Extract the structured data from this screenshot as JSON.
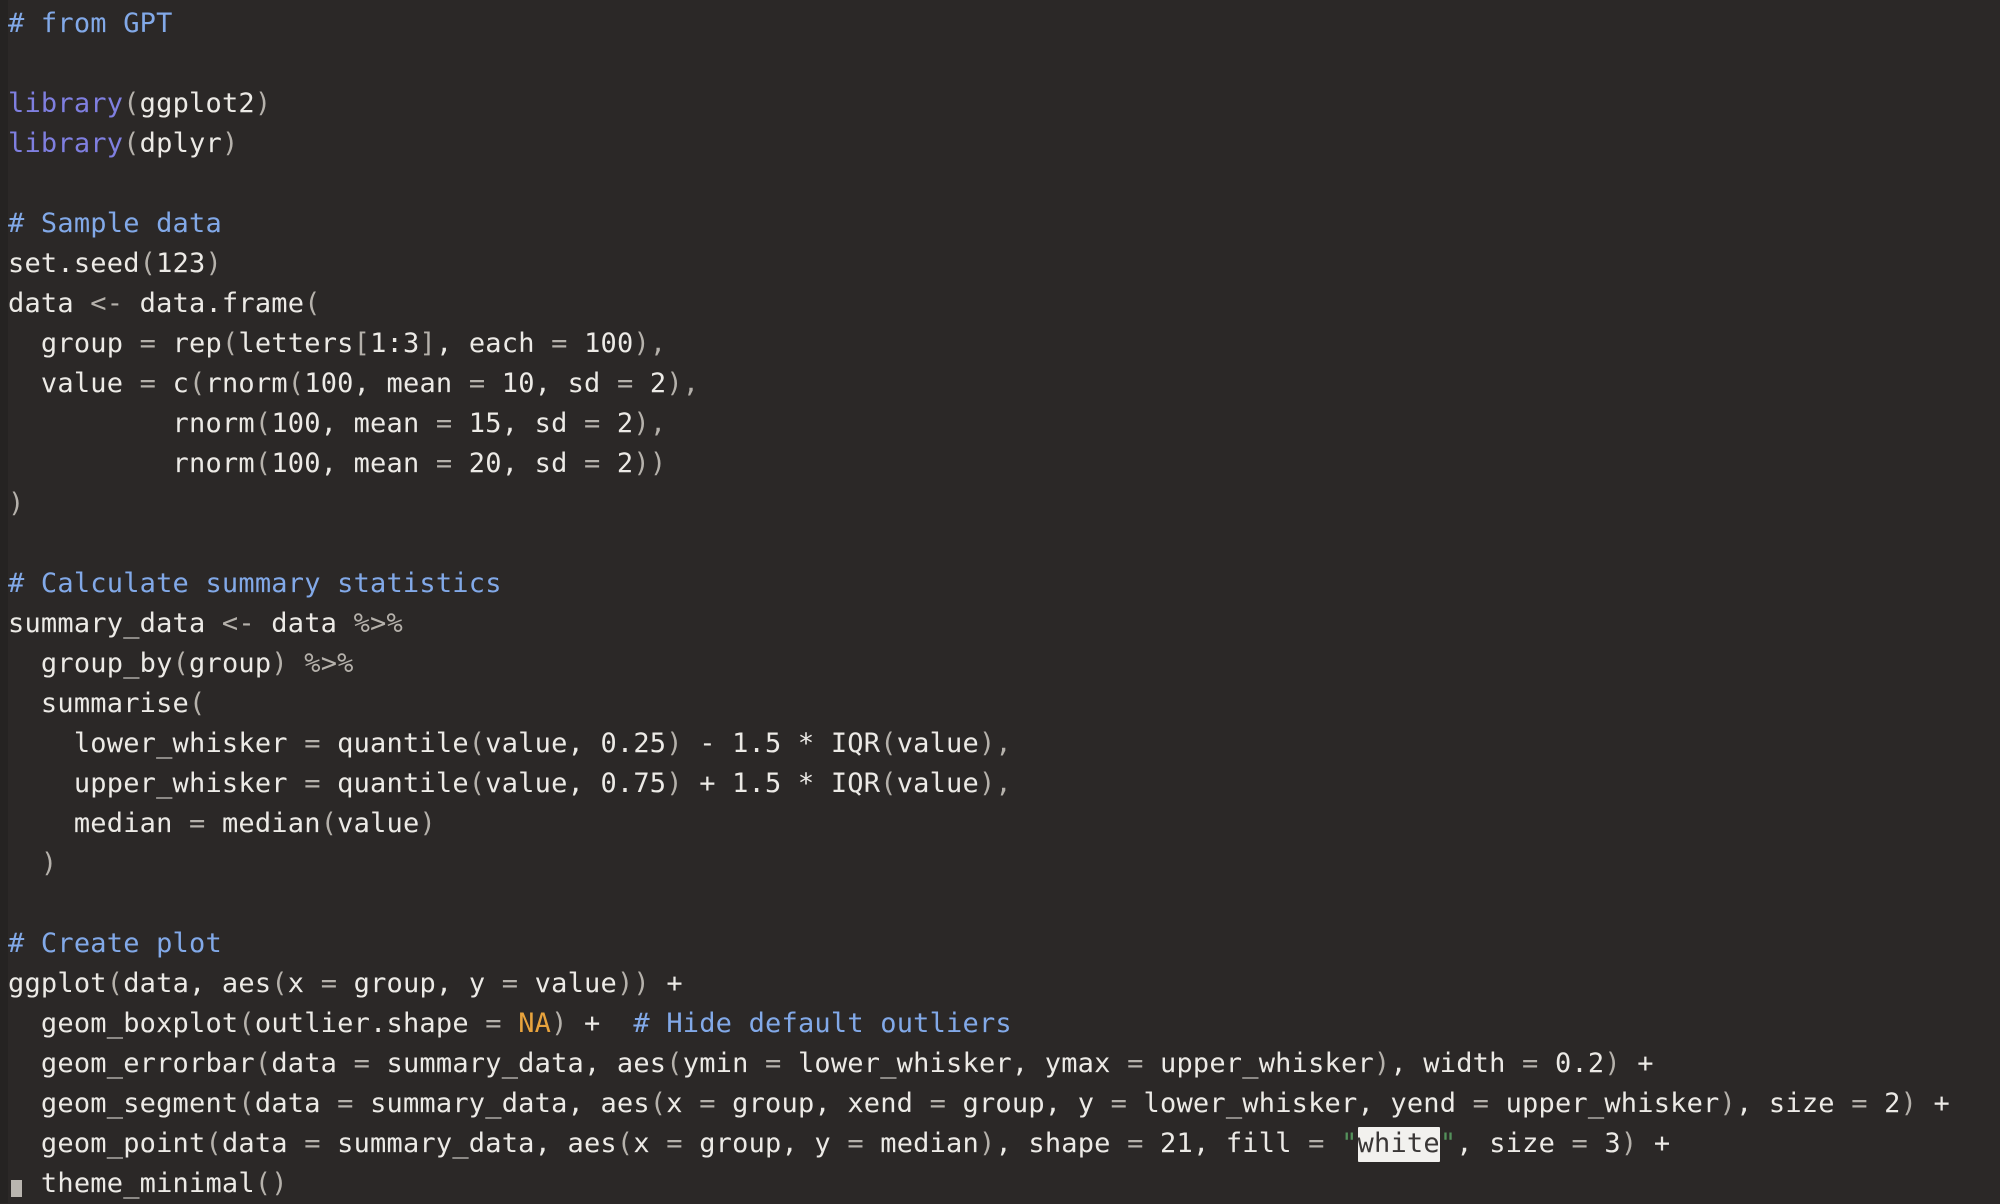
{
  "editor": {
    "language": "R",
    "theme": "dark",
    "background_color": "#2b2827",
    "gutter_color": "#252322",
    "colors": {
      "comment": "#82a9e8",
      "keyword": "#7f7fe0",
      "plain_text": "#eceae6",
      "punctuation": "#b5b1ab",
      "constant": "#e8a33d",
      "string": "#54915b",
      "selection_background": "#f2f1ee",
      "selection_text": "#3a3736",
      "caret": "#b9b5af"
    },
    "selection": {
      "selected_text": "white"
    },
    "caret": {
      "name": "text-cursor",
      "visible": true
    }
  },
  "code": {
    "lines": [
      {
        "n": 1,
        "segments": [
          {
            "t": "# from GPT",
            "c": "comment"
          }
        ]
      },
      {
        "n": 2,
        "segments": []
      },
      {
        "n": 3,
        "segments": [
          {
            "t": "library",
            "c": "keyword"
          },
          {
            "t": "(",
            "c": "punct"
          },
          {
            "t": "ggplot2",
            "c": "plain"
          },
          {
            "t": ")",
            "c": "punct"
          }
        ]
      },
      {
        "n": 4,
        "segments": [
          {
            "t": "library",
            "c": "keyword"
          },
          {
            "t": "(",
            "c": "punct"
          },
          {
            "t": "dplyr",
            "c": "plain"
          },
          {
            "t": ")",
            "c": "punct"
          }
        ]
      },
      {
        "n": 5,
        "segments": []
      },
      {
        "n": 6,
        "segments": [
          {
            "t": "# Sample data",
            "c": "comment"
          }
        ]
      },
      {
        "n": 7,
        "segments": [
          {
            "t": "set.seed",
            "c": "plain"
          },
          {
            "t": "(",
            "c": "punct"
          },
          {
            "t": "123",
            "c": "plain"
          },
          {
            "t": ")",
            "c": "punct"
          }
        ]
      },
      {
        "n": 8,
        "segments": [
          {
            "t": "data ",
            "c": "plain"
          },
          {
            "t": "<-",
            "c": "punct"
          },
          {
            "t": " data.frame",
            "c": "plain"
          },
          {
            "t": "(",
            "c": "punct"
          }
        ]
      },
      {
        "n": 9,
        "segments": [
          {
            "t": "  group ",
            "c": "plain"
          },
          {
            "t": "=",
            "c": "punct"
          },
          {
            "t": " rep",
            "c": "plain"
          },
          {
            "t": "(",
            "c": "punct"
          },
          {
            "t": "letters",
            "c": "plain"
          },
          {
            "t": "[",
            "c": "punct"
          },
          {
            "t": "1:3",
            "c": "plain"
          },
          {
            "t": "]",
            "c": "punct"
          },
          {
            "t": ", each ",
            "c": "plain"
          },
          {
            "t": "=",
            "c": "punct"
          },
          {
            "t": " 100",
            "c": "plain"
          },
          {
            "t": "),",
            "c": "punct"
          }
        ]
      },
      {
        "n": 10,
        "segments": [
          {
            "t": "  value ",
            "c": "plain"
          },
          {
            "t": "=",
            "c": "punct"
          },
          {
            "t": " c",
            "c": "plain"
          },
          {
            "t": "(",
            "c": "punct"
          },
          {
            "t": "rnorm",
            "c": "plain"
          },
          {
            "t": "(",
            "c": "punct"
          },
          {
            "t": "100, mean ",
            "c": "plain"
          },
          {
            "t": "=",
            "c": "punct"
          },
          {
            "t": " 10, sd ",
            "c": "plain"
          },
          {
            "t": "=",
            "c": "punct"
          },
          {
            "t": " 2",
            "c": "plain"
          },
          {
            "t": "),",
            "c": "punct"
          }
        ]
      },
      {
        "n": 11,
        "segments": [
          {
            "t": "          rnorm",
            "c": "plain"
          },
          {
            "t": "(",
            "c": "punct"
          },
          {
            "t": "100, mean ",
            "c": "plain"
          },
          {
            "t": "=",
            "c": "punct"
          },
          {
            "t": " 15, sd ",
            "c": "plain"
          },
          {
            "t": "=",
            "c": "punct"
          },
          {
            "t": " 2",
            "c": "plain"
          },
          {
            "t": "),",
            "c": "punct"
          }
        ]
      },
      {
        "n": 12,
        "segments": [
          {
            "t": "          rnorm",
            "c": "plain"
          },
          {
            "t": "(",
            "c": "punct"
          },
          {
            "t": "100, mean ",
            "c": "plain"
          },
          {
            "t": "=",
            "c": "punct"
          },
          {
            "t": " 20, sd ",
            "c": "plain"
          },
          {
            "t": "=",
            "c": "punct"
          },
          {
            "t": " 2",
            "c": "plain"
          },
          {
            "t": "))",
            "c": "punct"
          }
        ]
      },
      {
        "n": 13,
        "segments": [
          {
            "t": ")",
            "c": "punct"
          }
        ]
      },
      {
        "n": 14,
        "segments": []
      },
      {
        "n": 15,
        "segments": [
          {
            "t": "# Calculate summary statistics",
            "c": "comment"
          }
        ]
      },
      {
        "n": 16,
        "segments": [
          {
            "t": "summary_data ",
            "c": "plain"
          },
          {
            "t": "<-",
            "c": "punct"
          },
          {
            "t": " data ",
            "c": "plain"
          },
          {
            "t": "%>%",
            "c": "punct"
          }
        ]
      },
      {
        "n": 17,
        "segments": [
          {
            "t": "  group_by",
            "c": "plain"
          },
          {
            "t": "(",
            "c": "punct"
          },
          {
            "t": "group",
            "c": "plain"
          },
          {
            "t": ")",
            "c": "punct"
          },
          {
            "t": " ",
            "c": "plain"
          },
          {
            "t": "%>%",
            "c": "punct"
          }
        ]
      },
      {
        "n": 18,
        "segments": [
          {
            "t": "  summarise",
            "c": "plain"
          },
          {
            "t": "(",
            "c": "punct"
          }
        ]
      },
      {
        "n": 19,
        "segments": [
          {
            "t": "    lower_whisker ",
            "c": "plain"
          },
          {
            "t": "=",
            "c": "punct"
          },
          {
            "t": " quantile",
            "c": "plain"
          },
          {
            "t": "(",
            "c": "punct"
          },
          {
            "t": "value, 0.25",
            "c": "plain"
          },
          {
            "t": ")",
            "c": "punct"
          },
          {
            "t": " - 1.5 * ",
            "c": "plain"
          },
          {
            "t": "IQR",
            "c": "plain"
          },
          {
            "t": "(",
            "c": "punct"
          },
          {
            "t": "value",
            "c": "plain"
          },
          {
            "t": "),",
            "c": "punct"
          }
        ]
      },
      {
        "n": 20,
        "segments": [
          {
            "t": "    upper_whisker ",
            "c": "plain"
          },
          {
            "t": "=",
            "c": "punct"
          },
          {
            "t": " quantile",
            "c": "plain"
          },
          {
            "t": "(",
            "c": "punct"
          },
          {
            "t": "value, 0.75",
            "c": "plain"
          },
          {
            "t": ")",
            "c": "punct"
          },
          {
            "t": " + 1.5 * ",
            "c": "plain"
          },
          {
            "t": "IQR",
            "c": "plain"
          },
          {
            "t": "(",
            "c": "punct"
          },
          {
            "t": "value",
            "c": "plain"
          },
          {
            "t": "),",
            "c": "punct"
          }
        ]
      },
      {
        "n": 21,
        "segments": [
          {
            "t": "    median ",
            "c": "plain"
          },
          {
            "t": "=",
            "c": "punct"
          },
          {
            "t": " median",
            "c": "plain"
          },
          {
            "t": "(",
            "c": "punct"
          },
          {
            "t": "value",
            "c": "plain"
          },
          {
            "t": ")",
            "c": "punct"
          }
        ]
      },
      {
        "n": 22,
        "segments": [
          {
            "t": "  ",
            "c": "plain"
          },
          {
            "t": ")",
            "c": "punct"
          }
        ]
      },
      {
        "n": 23,
        "segments": []
      },
      {
        "n": 24,
        "segments": [
          {
            "t": "# Create plot",
            "c": "comment"
          }
        ]
      },
      {
        "n": 25,
        "segments": [
          {
            "t": "ggplot",
            "c": "plain"
          },
          {
            "t": "(",
            "c": "punct"
          },
          {
            "t": "data, aes",
            "c": "plain"
          },
          {
            "t": "(",
            "c": "punct"
          },
          {
            "t": "x ",
            "c": "plain"
          },
          {
            "t": "=",
            "c": "punct"
          },
          {
            "t": " group, y ",
            "c": "plain"
          },
          {
            "t": "=",
            "c": "punct"
          },
          {
            "t": " value",
            "c": "plain"
          },
          {
            "t": "))",
            "c": "punct"
          },
          {
            "t": " + ",
            "c": "plain"
          }
        ]
      },
      {
        "n": 26,
        "segments": [
          {
            "t": "  geom_boxplot",
            "c": "plain"
          },
          {
            "t": "(",
            "c": "punct"
          },
          {
            "t": "outlier.shape ",
            "c": "plain"
          },
          {
            "t": "=",
            "c": "punct"
          },
          {
            "t": " ",
            "c": "plain"
          },
          {
            "t": "NA",
            "c": "const"
          },
          {
            "t": ")",
            "c": "punct"
          },
          {
            "t": " + ",
            "c": "plain"
          },
          {
            "t": " # Hide default outliers",
            "c": "comment"
          }
        ]
      },
      {
        "n": 27,
        "segments": [
          {
            "t": "  geom_errorbar",
            "c": "plain"
          },
          {
            "t": "(",
            "c": "punct"
          },
          {
            "t": "data ",
            "c": "plain"
          },
          {
            "t": "=",
            "c": "punct"
          },
          {
            "t": " summary_data, aes",
            "c": "plain"
          },
          {
            "t": "(",
            "c": "punct"
          },
          {
            "t": "ymin ",
            "c": "plain"
          },
          {
            "t": "=",
            "c": "punct"
          },
          {
            "t": " lower_whisker, ymax ",
            "c": "plain"
          },
          {
            "t": "=",
            "c": "punct"
          },
          {
            "t": " upper_whisker",
            "c": "plain"
          },
          {
            "t": ")",
            "c": "punct"
          },
          {
            "t": ", width ",
            "c": "plain"
          },
          {
            "t": "=",
            "c": "punct"
          },
          {
            "t": " 0.2",
            "c": "plain"
          },
          {
            "t": ")",
            "c": "punct"
          },
          {
            "t": " + ",
            "c": "plain"
          }
        ]
      },
      {
        "n": 28,
        "segments": [
          {
            "t": "  geom_segment",
            "c": "plain"
          },
          {
            "t": "(",
            "c": "punct"
          },
          {
            "t": "data ",
            "c": "plain"
          },
          {
            "t": "=",
            "c": "punct"
          },
          {
            "t": " summary_data, aes",
            "c": "plain"
          },
          {
            "t": "(",
            "c": "punct"
          },
          {
            "t": "x ",
            "c": "plain"
          },
          {
            "t": "=",
            "c": "punct"
          },
          {
            "t": " group, xend ",
            "c": "plain"
          },
          {
            "t": "=",
            "c": "punct"
          },
          {
            "t": " group, y ",
            "c": "plain"
          },
          {
            "t": "=",
            "c": "punct"
          },
          {
            "t": " lower_whisker, yend ",
            "c": "plain"
          },
          {
            "t": "=",
            "c": "punct"
          },
          {
            "t": " upper_whisker",
            "c": "plain"
          },
          {
            "t": ")",
            "c": "punct"
          },
          {
            "t": ", size ",
            "c": "plain"
          },
          {
            "t": "=",
            "c": "punct"
          },
          {
            "t": " 2",
            "c": "plain"
          },
          {
            "t": ")",
            "c": "punct"
          },
          {
            "t": " + ",
            "c": "plain"
          }
        ]
      },
      {
        "n": 29,
        "segments": [
          {
            "t": "  geom_point",
            "c": "plain"
          },
          {
            "t": "(",
            "c": "punct"
          },
          {
            "t": "data ",
            "c": "plain"
          },
          {
            "t": "=",
            "c": "punct"
          },
          {
            "t": " summary_data, aes",
            "c": "plain"
          },
          {
            "t": "(",
            "c": "punct"
          },
          {
            "t": "x ",
            "c": "plain"
          },
          {
            "t": "=",
            "c": "punct"
          },
          {
            "t": " group, y ",
            "c": "plain"
          },
          {
            "t": "=",
            "c": "punct"
          },
          {
            "t": " median",
            "c": "plain"
          },
          {
            "t": ")",
            "c": "punct"
          },
          {
            "t": ", shape ",
            "c": "plain"
          },
          {
            "t": "=",
            "c": "punct"
          },
          {
            "t": " 21, fill ",
            "c": "plain"
          },
          {
            "t": "=",
            "c": "punct"
          },
          {
            "t": " ",
            "c": "plain"
          },
          {
            "t": "\"",
            "c": "string"
          },
          {
            "t": "white",
            "c": "selected"
          },
          {
            "t": "\"",
            "c": "string"
          },
          {
            "t": ", size ",
            "c": "plain"
          },
          {
            "t": "=",
            "c": "punct"
          },
          {
            "t": " 3",
            "c": "plain"
          },
          {
            "t": ")",
            "c": "punct"
          },
          {
            "t": " + ",
            "c": "plain"
          }
        ]
      },
      {
        "n": 30,
        "segments": [
          {
            "t": "  theme_minimal",
            "c": "plain"
          },
          {
            "t": "()",
            "c": "punct"
          }
        ]
      }
    ]
  }
}
